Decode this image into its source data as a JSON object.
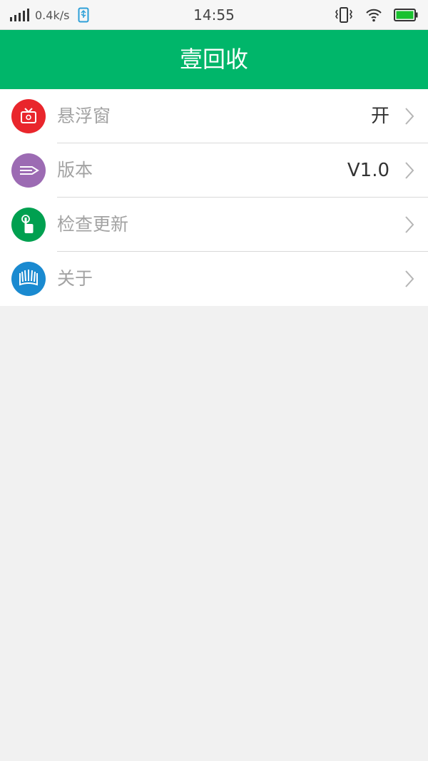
{
  "status_bar": {
    "net_speed": "0.4k/s",
    "time": "14:55",
    "icons": [
      "signal-icon",
      "usb-icon",
      "vibrate-icon",
      "wifi-icon",
      "battery-icon"
    ]
  },
  "header": {
    "title": "壹回收",
    "background": "#00b66a"
  },
  "menu": {
    "items": [
      {
        "label": "悬浮窗",
        "value": "开",
        "icon": "tv-icon",
        "icon_color": "#e9262c"
      },
      {
        "label": "版本",
        "value": "V1.0",
        "icon": "pen-icon",
        "icon_color": "#9c6bb3"
      },
      {
        "label": "检查更新",
        "value": "",
        "icon": "tap-icon",
        "icon_color": "#00a050"
      },
      {
        "label": "关于",
        "value": "",
        "icon": "book-icon",
        "icon_color": "#1a8ad0"
      }
    ]
  }
}
